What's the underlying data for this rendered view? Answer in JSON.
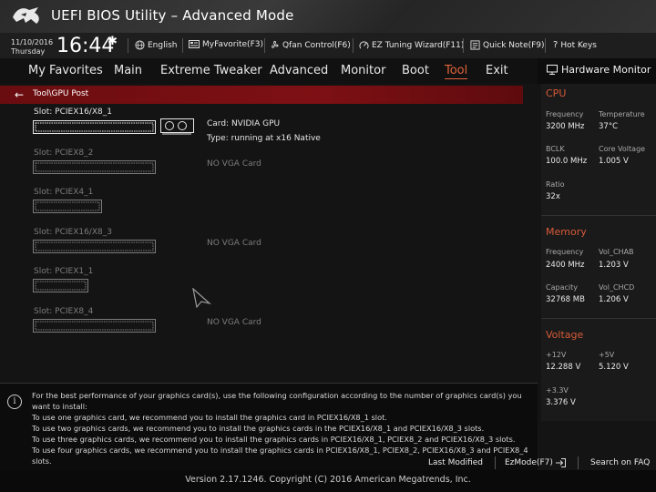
{
  "app": {
    "title": "UEFI BIOS Utility – Advanced Mode"
  },
  "topbar": {
    "date": "11/10/2016",
    "day": "Thursday",
    "time": "16:44",
    "items": [
      {
        "label": "English",
        "icon": "globe-icon"
      },
      {
        "label": "MyFavorite(F3)",
        "icon": "favorite-icon"
      },
      {
        "label": "Qfan Control(F6)",
        "icon": "fan-icon"
      },
      {
        "label": "EZ Tuning Wizard(F11)",
        "icon": "tuning-icon"
      },
      {
        "label": "Quick Note(F9)",
        "icon": "note-icon"
      },
      {
        "label": "Hot Keys",
        "icon": "hotkeys-icon"
      }
    ]
  },
  "menu": {
    "items": [
      "My Favorites",
      "Main",
      "Extreme Tweaker",
      "Advanced",
      "Monitor",
      "Boot",
      "Tool",
      "Exit"
    ],
    "active": "Tool"
  },
  "breadcrumb": {
    "path": "Tool\\GPU Post"
  },
  "slots": [
    {
      "name": "Slot: PCIEX16/X8_1",
      "card": "Card: NVIDIA GPU",
      "status": "Type: running at x16 Native",
      "populated": true,
      "size": "x16"
    },
    {
      "name": "Slot: PCIEX8_2",
      "card": "NO VGA Card",
      "status": "",
      "populated": false,
      "size": "x16"
    },
    {
      "name": "Slot: PCIEX4_1",
      "card": "",
      "status": "",
      "populated": false,
      "size": "x4"
    },
    {
      "name": "Slot: PCIEX16/X8_3",
      "card": "NO VGA Card",
      "status": "",
      "populated": false,
      "size": "x16"
    },
    {
      "name": "Slot: PCIEX1_1",
      "card": "",
      "status": "",
      "populated": false,
      "size": "x1"
    },
    {
      "name": "Slot: PCIEX8_4",
      "card": "NO VGA Card",
      "status": "",
      "populated": false,
      "size": "x16"
    }
  ],
  "hardware_monitor": {
    "title": "Hardware Monitor",
    "cpu": {
      "heading": "CPU",
      "frequency_label": "Frequency",
      "frequency": "3200 MHz",
      "temperature_label": "Temperature",
      "temperature": "37°C",
      "bclk_label": "BCLK",
      "bclk": "100.0 MHz",
      "core_voltage_label": "Core Voltage",
      "core_voltage": "1.005 V",
      "ratio_label": "Ratio",
      "ratio": "32x"
    },
    "memory": {
      "heading": "Memory",
      "frequency_label": "Frequency",
      "frequency": "2400 MHz",
      "vol_chab_label": "Vol_CHAB",
      "vol_chab": "1.203 V",
      "capacity_label": "Capacity",
      "capacity": "32768 MB",
      "vol_chcd_label": "Vol_CHCD",
      "vol_chcd": "1.206 V"
    },
    "voltage": {
      "heading": "Voltage",
      "v12_label": "+12V",
      "v12": "12.288 V",
      "v5_label": "+5V",
      "v5": "5.120 V",
      "v33_label": "+3.3V",
      "v33": "3.376 V"
    }
  },
  "help": {
    "lines": [
      "For the best performance of your graphics card(s), use the following configuration according to the number of graphics card(s) you",
      "want to install:",
      "To use one graphics card, we recommend you to install the graphics card in PCIEX16/X8_1 slot.",
      "To use two graphics cards, we recommend you to install the graphics cards in the PCIEX16/X8_1 and PCIEX16/X8_3 slots.",
      "To use three graphics cards, we recommend you to install the graphics cards in PCIEX16/X8_1, PCIEX8_2 and PCIEX16/X8_3 slots.",
      "To use four graphics cards, we recommend you to install the graphics cards in PCIEX16/X8_1, PCIEX8_2, PCIEX16/X8_3 and PCIEX8_4",
      "slots."
    ]
  },
  "bottom": {
    "last_modified": "Last Modified",
    "ezmode": "EzMode(F7)",
    "search": "Search on FAQ"
  },
  "footer": {
    "text": "Version 2.17.1246. Copyright (C) 2016 American Megatrends, Inc."
  },
  "colors": {
    "accent": "#e0623a",
    "breadcrumb_bg": "#7a0f12",
    "section_heading": "#d85a38"
  }
}
